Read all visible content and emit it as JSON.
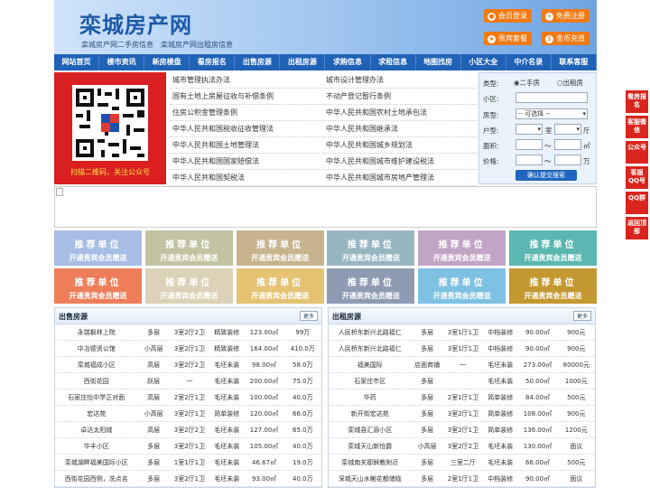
{
  "header": {
    "logo": "栾城房产网",
    "sub": [
      "栾城房产网二手房信息",
      "栾城房产网出租房信息"
    ],
    "buttons": [
      "会员登录",
      "免费注册",
      "贵宾套餐",
      "金币充值"
    ]
  },
  "nav": [
    "网站首页",
    "楼市资讯",
    "新房楼盘",
    "看房报名",
    "出售房源",
    "出租房源",
    "求购信息",
    "求租信息",
    "地图找房",
    "小区大全",
    "中介名录",
    "联系客服"
  ],
  "qr": {
    "caption": "扫描二维码，关注公众号"
  },
  "links": [
    [
      "城市管理执法办法",
      "城市设计管理办法"
    ],
    [
      "国有土地上房屋征收与补偿条例",
      "不动产登记暂行条例"
    ],
    [
      "住房公积金管理条例",
      "中华人民共和国农村土地承包法"
    ],
    [
      "中华人民共和国税收征收管理法",
      "中华人民共和国继承法"
    ],
    [
      "中华人民共和国土地管理法",
      "中华人民共和国城乡规划法"
    ],
    [
      "中华人民共和国国家赔偿法",
      "中华人民共和国城市维护建设税法"
    ],
    [
      "中华人民共和国契税法",
      "中华人民共和国城市房地产管理法"
    ]
  ],
  "search": {
    "type_label": "类型:",
    "type_options": [
      "二手房",
      "出租房"
    ],
    "community_label": "小区:",
    "housetype_label": "房型:",
    "housetype_value": "-- 可选择 --",
    "layout_label": "户型:",
    "room_unit": "室",
    "hall_unit": "厅",
    "area_label": "面积:",
    "area_unit": "㎡",
    "price_label": "价格:",
    "price_unit": "万",
    "range_sep": "～",
    "submit": "确认提交搜索"
  },
  "ads": {
    "t1": "推荐单位",
    "t2": "开通贵宾会员赠送"
  },
  "ad_colors": [
    "#a7bde4",
    "#c3c3a3",
    "#c7b48e",
    "#97b6c2",
    "#c0a5c4",
    "#5bb7b0",
    "#ee7e5a",
    "#dbd2b7",
    "#e4c373",
    "#8e9bb3",
    "#7fc1e2",
    "#c49830"
  ],
  "sale": {
    "title": "出售房源",
    "more": "更多",
    "rows": [
      [
        "永瑞枫林上院",
        "多层",
        "3室2厅2卫",
        "精致装修",
        "123.00㎡",
        "99万"
      ],
      [
        "中冶德贤公馆",
        "小高层",
        "3室2厅1卫",
        "精致装修",
        "164.00㎡",
        "410.0万"
      ],
      [
        "栾城福成小区",
        "高层",
        "3室2厅2卫",
        "毛坯未装",
        "98.00㎡",
        "58.0万"
      ],
      [
        "西街花园",
        "跃层",
        "一",
        "毛坯未装",
        "200.00㎡",
        "75.0万"
      ],
      [
        "石家庄怡中学正对面",
        "高层",
        "2室2厅1卫",
        "毛坯未装",
        "100.00㎡",
        "40.0万"
      ],
      [
        "宏达苑",
        "小高层",
        "3室2厅1卫",
        "简单装修",
        "120.00㎡",
        "66.0万"
      ],
      [
        "卓达太阳城",
        "高层",
        "3室2厅2卫",
        "毛坯未装",
        "127.00㎡",
        "65.0万"
      ],
      [
        "华丰小区",
        "多层",
        "3室2厅1卫",
        "毛坯未装",
        "105.00㎡",
        "40.0万"
      ],
      [
        "栾城湖畔福美国际小区",
        "多层",
        "1室1厅1卫",
        "毛坯未装",
        "46.67㎡",
        "19.0万"
      ],
      [
        "西街花园西侧，冼点名",
        "多层",
        "3室2厅1卫",
        "毛坯未装",
        "93.00㎡",
        "40.0万"
      ]
    ]
  },
  "rent": {
    "title": "出租房源",
    "more": "更多",
    "rows": [
      [
        "人民桥东新兴北路福仁",
        "多层",
        "3室1厅1卫",
        "中档装修",
        "90.00㎡",
        "900元"
      ],
      [
        "人民桥东新兴北路福仁",
        "多层",
        "3室1厅1卫",
        "中档装修",
        "90.00㎡",
        "900元"
      ],
      [
        "福美国际",
        "店面商铺",
        "一",
        "毛坯未装",
        "273.00㎡",
        "80000元"
      ],
      [
        "石家庄市区",
        "多层",
        "",
        "毛坯未装",
        "50.00㎡",
        "1000元"
      ],
      [
        "华药",
        "多层",
        "2室1厅1卫",
        "简单装修",
        "84.00㎡",
        "500元"
      ],
      [
        "新开街宏达苑",
        "多层",
        "3室2厅1卫",
        "简单装修",
        "108.00㎡",
        "900元"
      ],
      [
        "栾城县汇源小区",
        "多层",
        "3室2厅1卫",
        "简单装修",
        "136.00㎡",
        "1200元"
      ],
      [
        "栾城天山新怡爵",
        "小高层",
        "3室2厅2卫",
        "毛坯未装",
        "130.00㎡",
        "面议"
      ],
      [
        "栾城南关耶稣教附近",
        "多层",
        "三室二厅",
        "毛坯未装",
        "66.00㎡",
        "500元"
      ],
      [
        "深城天山水榭花都储临",
        "多层",
        "2室1厅1卫",
        "中档装修",
        "90.00㎡",
        "面议"
      ]
    ]
  },
  "sidebar": [
    "看房报名",
    "客服微信",
    "公众号",
    "客服QQ号",
    "QQ群",
    "返回顶部"
  ]
}
